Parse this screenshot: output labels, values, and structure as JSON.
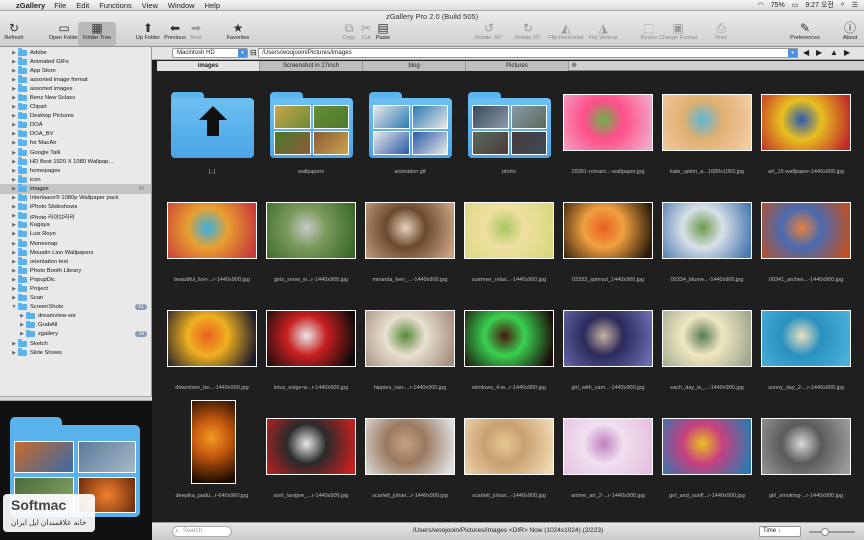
{
  "menubar": {
    "app_name": "zGallery",
    "menus": [
      "File",
      "Edit",
      "Functions",
      "View",
      "Window",
      "Help"
    ],
    "battery": "75%",
    "clock": "9:27 오전"
  },
  "window": {
    "title": "zGallery Pro 2.0 (Build 505)"
  },
  "toolbar": {
    "refresh": "Refresh",
    "open_folder": "Open Folder",
    "folder_tree": "Folder Tree",
    "up_folder": "Up Folder",
    "previous": "Previous",
    "next": "Next",
    "favorites": "Favorites",
    "copy": "Copy",
    "cut": "Cut",
    "paste": "Paste",
    "rotate_left": "Rotate -90°",
    "rotate_right": "Rotate 90°",
    "flip_horizontal": "Flip Horizontal",
    "flip_vertical": "Flip Vertical",
    "resize": "Resize",
    "change_format": "Change Format",
    "print": "Print",
    "preferences": "Preferences",
    "about": "About"
  },
  "sidebar": {
    "items": [
      {
        "label": "Adobe",
        "count": ""
      },
      {
        "label": "Animated GIFs",
        "count": ""
      },
      {
        "label": "App Store",
        "count": ""
      },
      {
        "label": "assorted image format",
        "count": ""
      },
      {
        "label": "assorted images",
        "count": ""
      },
      {
        "label": "Benz New Sclass",
        "count": ""
      },
      {
        "label": "Clipart",
        "count": ""
      },
      {
        "label": "Desktop Pictures",
        "count": ""
      },
      {
        "label": "DOA",
        "count": ""
      },
      {
        "label": "DOA_BV",
        "count": ""
      },
      {
        "label": "for MacAir",
        "count": ""
      },
      {
        "label": "Google Talk",
        "count": ""
      },
      {
        "label": "HD Best 1920 X 1080 Wallpap...",
        "count": ""
      },
      {
        "label": "homepages",
        "count": ""
      },
      {
        "label": "icon",
        "count": ""
      },
      {
        "label": "images",
        "count": "30"
      },
      {
        "label": "Interlaace® 1080p Wallpaper pack",
        "count": ""
      },
      {
        "label": "iPhoto Slideshows",
        "count": ""
      },
      {
        "label": "iPhoto 라이브러리",
        "count": ""
      },
      {
        "label": "Kagaya",
        "count": ""
      },
      {
        "label": "Luis Royo",
        "count": ""
      },
      {
        "label": "Moneenap",
        "count": ""
      },
      {
        "label": "Mouatin Lion Wallpapers",
        "count": ""
      },
      {
        "label": "orientation test",
        "count": ""
      },
      {
        "label": "Photo Booth Library",
        "count": ""
      },
      {
        "label": "PopupDic",
        "count": ""
      },
      {
        "label": "Project",
        "count": ""
      },
      {
        "label": "Scan",
        "count": ""
      },
      {
        "label": "ScreenShots",
        "count": "51"
      },
      {
        "label": "dreamview-sor",
        "count": ""
      },
      {
        "label": "GrabAll",
        "count": ""
      },
      {
        "label": "zgallery",
        "count": "19"
      },
      {
        "label": "Sketch",
        "count": ""
      },
      {
        "label": "Slide Shows",
        "count": ""
      }
    ]
  },
  "pathbar": {
    "volume": "Macintosh HD",
    "path": "/Users/woojooin/Pictures/images"
  },
  "tabs": [
    "images",
    "Screenshot in 27inch",
    "blog",
    "Pictures"
  ],
  "grid": {
    "items": [
      {
        "name": "[..]",
        "kind": "up",
        "colors": [
          "#5cb4ee"
        ]
      },
      {
        "name": "wallpapers",
        "kind": "folder",
        "colors": [
          "#c9a64a",
          "#6a8c3a",
          "#4a7a2a",
          "#8c5a3a"
        ]
      },
      {
        "name": "animation gif",
        "kind": "folder",
        "colors": [
          "#e8e8e8",
          "#2a7ab0",
          "#e8e8e8",
          "#2a5aa8"
        ]
      },
      {
        "name": "photo",
        "kind": "folder",
        "colors": [
          "#3a4a5a",
          "#8a9aaa",
          "#5a6a5a",
          "#4a3a3a"
        ]
      },
      {
        "name": "29391-romant...-wallpaper.jpg",
        "kind": "image",
        "colors": [
          "#f2a6c8",
          "#6bb04a",
          "#ff4e8a"
        ]
      },
      {
        "name": "kate_upton_a...1680x1050.jpg",
        "kind": "image",
        "colors": [
          "#f3c9a0",
          "#5fb6d8",
          "#e0b070"
        ]
      },
      {
        "name": "art_15-wallpaper-1440x900.jpg",
        "kind": "image",
        "colors": [
          "#c02828",
          "#2a5ab0",
          "#e8c020"
        ]
      },
      {
        "name": "beautiful_lion-...r-1440x900.jpg",
        "kind": "image",
        "colors": [
          "#c83a3a",
          "#3ab0e0",
          "#e8a030"
        ]
      },
      {
        "name": "girls_snow_w...r-1440x900.jpg",
        "kind": "image",
        "colors": [
          "#3a6a2a",
          "#c8c8c8",
          "#7a9a5a"
        ]
      },
      {
        "name": "miranda_kerr_...-1440x900.jpg",
        "kind": "image",
        "colors": [
          "#c8a080",
          "#e8d0b8",
          "#6a4a30"
        ]
      },
      {
        "name": "summer_relax...-1440x900.jpg",
        "kind": "image",
        "colors": [
          "#d8d880",
          "#a8c860",
          "#f0e0a0"
        ]
      },
      {
        "name": "03333_spinout_1440x900.jpg",
        "kind": "image",
        "colors": [
          "#2a1a0a",
          "#e86020",
          "#f0a040"
        ]
      },
      {
        "name": "00334_blume...-1440x900.jpg",
        "kind": "image",
        "colors": [
          "#4a7ab0",
          "#6a9a4a",
          "#d8e0e8"
        ]
      },
      {
        "name": "00341_arches...-1440x900.jpg",
        "kind": "image",
        "colors": [
          "#c05020",
          "#e88040",
          "#4a6ab0"
        ]
      },
      {
        "name": "downtown_be...-1440x900.jpg",
        "kind": "image",
        "colors": [
          "#1a1a2a",
          "#e86020",
          "#f0b020"
        ]
      },
      {
        "name": "lotus_exige-w...r-1440x900.jpg",
        "kind": "image",
        "colors": [
          "#0a0a0a",
          "#e8e8e8",
          "#c82020"
        ]
      },
      {
        "name": "hippies_van-...r-1440x900.jpg",
        "kind": "image",
        "colors": [
          "#a89080",
          "#5a8a3a",
          "#e8e0d0"
        ]
      },
      {
        "name": "windows_4-w...r-1440x900.jpg",
        "kind": "image",
        "colors": [
          "#1a0a08",
          "#4a1a10",
          "#3ad050"
        ]
      },
      {
        "name": "girl_with_cam...-1440x900.jpg",
        "kind": "image",
        "colors": [
          "#6a6ab0",
          "#c8b0a0",
          "#2a2a5a"
        ]
      },
      {
        "name": "each_day_is_...-1440x900.jpg",
        "kind": "image",
        "colors": [
          "#a0a890",
          "#5a7a5a",
          "#f0e8c0"
        ]
      },
      {
        "name": "sunny_day_2-...r-1440x900.jpg",
        "kind": "image",
        "colors": [
          "#4ab0d8",
          "#e8e0c0",
          "#2a90c0"
        ]
      },
      {
        "name": "deepika_padu...r-640x960.jpg",
        "kind": "tall",
        "colors": [
          "#1a0a00",
          "#f09a20",
          "#c85a10"
        ]
      },
      {
        "name": "avril_lavigne_...r-1440x900.jpg",
        "kind": "image",
        "colors": [
          "#c82020",
          "#e8e8e8",
          "#2a2a2a"
        ]
      },
      {
        "name": "scarlett_johan...r-1440x900.jpg",
        "kind": "image",
        "colors": [
          "#e0e0e0",
          "#c8a080",
          "#9a7a60"
        ]
      },
      {
        "name": "scarlett_johan...-1440x900.jpg",
        "kind": "image",
        "colors": [
          "#f0d8b0",
          "#e8c890",
          "#c8a070"
        ]
      },
      {
        "name": "anime_art_2-...r-1440x900.jpg",
        "kind": "image",
        "colors": [
          "#e8c0e0",
          "#c080c0",
          "#f0e0f0"
        ]
      },
      {
        "name": "girl_and_sunfl...r-1440x900.jpg",
        "kind": "image",
        "colors": [
          "#2a7ab0",
          "#e8c020",
          "#c84080"
        ]
      },
      {
        "name": "girl_smoking-...r-1440x900.jpg",
        "kind": "image",
        "colors": [
          "#9a9a9a",
          "#d8d8d8",
          "#5a5a5a"
        ]
      }
    ]
  },
  "statusbar": {
    "search_placeholder": "Search",
    "status": "/Users/woojooin/Pictures/images <DIR> Now (1024x1024) (2/223)",
    "sort": "Time ↓"
  },
  "watermark": {
    "title": "Softmac",
    "subtitle": "خانه علاقمندان اپل ایران"
  }
}
